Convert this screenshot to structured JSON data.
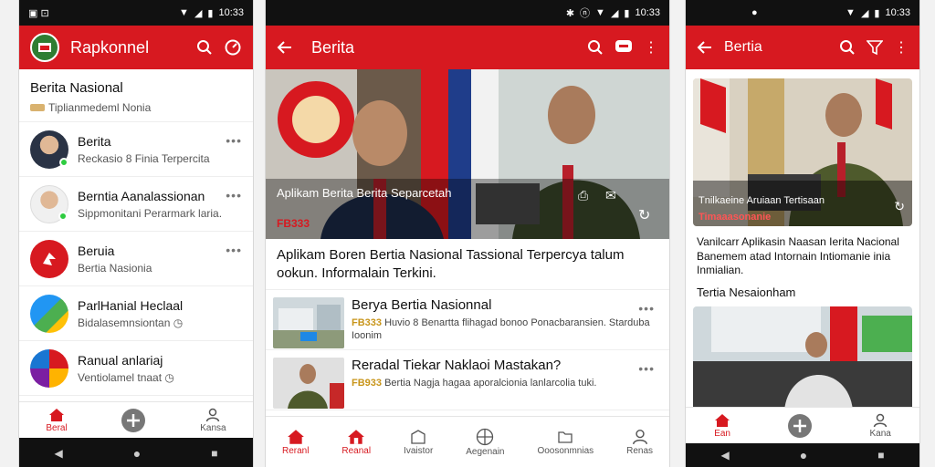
{
  "status": {
    "time": "10:33"
  },
  "phone1": {
    "brand": "Rapkonnel",
    "section_title": "Berita Nasional",
    "section_sub": "Tiplianmedeml Nonia",
    "items": [
      {
        "title": "Berita",
        "sub": "Reckasio 8 Finia Terpercita"
      },
      {
        "title": "Berntia Aanalassionan",
        "sub": "Sippmonitani Perarmark laria."
      },
      {
        "title": "Beruia",
        "sub": "Bertia Nasionia"
      },
      {
        "title": "ParlHanial Heclaal",
        "sub": "Bidalasemnsiontan"
      },
      {
        "title": "Ranual anlariaj",
        "sub": "Ventiolamel tnaat"
      }
    ],
    "nav": {
      "home": "Beral",
      "profile": "Kansa"
    }
  },
  "phone2": {
    "title": "Berita",
    "hero_caption": "Aplikam Berita Berita Separcetah",
    "hero_badge": "FB333",
    "headline": "Aplikam Boren Bertia Nasional Tassional Terpercya talum ookun. Informalain Terkini.",
    "news": [
      {
        "title": "Berya Bertia Nasionnal",
        "tag": "FB333",
        "sub": "Huvio 8 Benartta flihagad bonoo Ponacbaransien. Starduba Ioonim"
      },
      {
        "title": "Reradal Tiekar Naklaoi Mastakan?",
        "tag": "FB933",
        "sub": "Bertia Nagja hagaa aporalcionia lanlarcolia tuki."
      }
    ],
    "tabs": [
      "Reranl",
      "Reanal",
      "Ivaistor",
      "Aegenain",
      "Ooosonmnias",
      "Renas"
    ]
  },
  "phone3": {
    "title": "Bertia",
    "card_caption": "Tnilkaeine Aruiaan Tertisaan",
    "card_tag": "Timaaasonanie",
    "summary": "Vanilcarr Aplikasin Naasan Ierita Nacional Banemem atad Intornain Intiomanie inia Inmialian.",
    "section": "Tertia Nesaionham",
    "nav": {
      "home": "Ean",
      "profile": "Kana"
    }
  },
  "colors": {
    "accent": "#d71920",
    "tag_gold": "#c8951a"
  }
}
